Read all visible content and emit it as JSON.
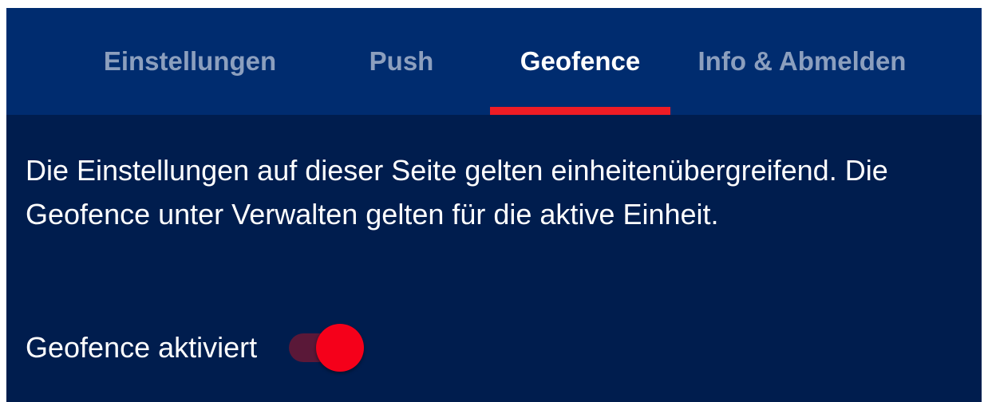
{
  "tabs": [
    {
      "label": "Einstellungen",
      "active": false
    },
    {
      "label": "Push",
      "active": false
    },
    {
      "label": "Geofence",
      "active": true
    },
    {
      "label": "Info & Abmelden",
      "active": false
    }
  ],
  "description": "Die Einstellungen auf dieser Seite gelten einheitenübergreifend. Die Geofence unter Verwalten gelten für die aktive Einheit.",
  "geofence_toggle": {
    "label": "Geofence aktiviert",
    "on": true
  },
  "colors": {
    "tabbar_background": "#002c6f",
    "content_background": "#001d4e",
    "active_indicator": "#ee1c25",
    "switch_thumb": "#f5001a",
    "inactive_tab_text": "#8c9fbe"
  }
}
